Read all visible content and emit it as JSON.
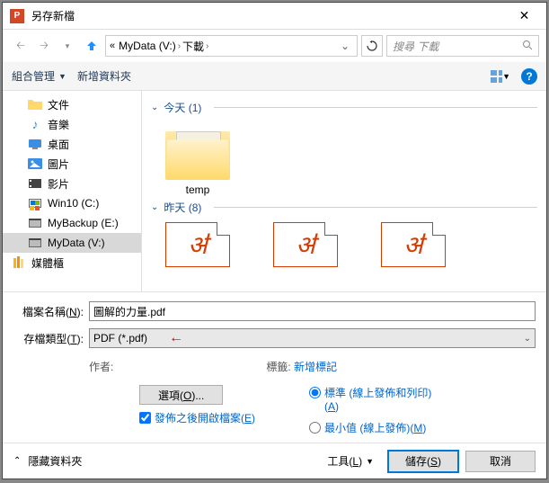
{
  "title": "另存新檔",
  "breadcrumb": {
    "drive": "MyData (V:)",
    "folder": "下載"
  },
  "search_placeholder": "搜尋 下載",
  "toolbar": {
    "organize": "組合管理",
    "new_folder": "新增資料夾"
  },
  "tree": [
    {
      "label": "文件",
      "indent": true,
      "selected": false,
      "iconColor": "#ffd96b"
    },
    {
      "label": "音樂",
      "indent": true,
      "selected": false,
      "iconColor": "#3a8ee6",
      "icon": "music"
    },
    {
      "label": "桌面",
      "indent": true,
      "selected": false,
      "iconColor": "#3a8ee6",
      "icon": "desktop"
    },
    {
      "label": "圖片",
      "indent": true,
      "selected": false,
      "iconColor": "#3a8ee6",
      "icon": "picture"
    },
    {
      "label": "影片",
      "indent": true,
      "selected": false,
      "iconColor": "#444",
      "icon": "video"
    },
    {
      "label": "Win10 (C:)",
      "indent": true,
      "selected": false,
      "icon": "win"
    },
    {
      "label": "MyBackup (E:)",
      "indent": true,
      "selected": false,
      "icon": "drive"
    },
    {
      "label": "MyData (V:)",
      "indent": true,
      "selected": true,
      "icon": "drive"
    },
    {
      "label": "媒體櫃",
      "indent": false,
      "selected": false,
      "iconColor": "#ffb400",
      "icon": "library"
    }
  ],
  "groups": [
    {
      "title": "今天",
      "count": "(1)",
      "items": [
        {
          "type": "folder",
          "label": "temp"
        }
      ]
    },
    {
      "title": "昨天",
      "count": "(8)",
      "items": [
        {
          "type": "pdf"
        },
        {
          "type": "pdf"
        },
        {
          "type": "pdf"
        }
      ]
    }
  ],
  "filename": {
    "label": "檔案名稱(N):",
    "value": "圖解的力量.pdf"
  },
  "filetype": {
    "label": "存檔類型(T):",
    "value": "PDF (*.pdf)"
  },
  "meta": {
    "author_label": "作者:",
    "tags_label": "標籤:",
    "tags_value": "新增標記"
  },
  "options": {
    "button": "選項(O)...",
    "checkbox": "發佈之後開啟檔案(E)",
    "radio1a": "標準 (線上發佈和列印)",
    "radio1b": "(A)",
    "radio2": "最小值 (線上發佈)(M)"
  },
  "footer": {
    "hide": "隱藏資料夾",
    "tools": "工具(L)",
    "save": "儲存(S)",
    "cancel": "取消"
  }
}
